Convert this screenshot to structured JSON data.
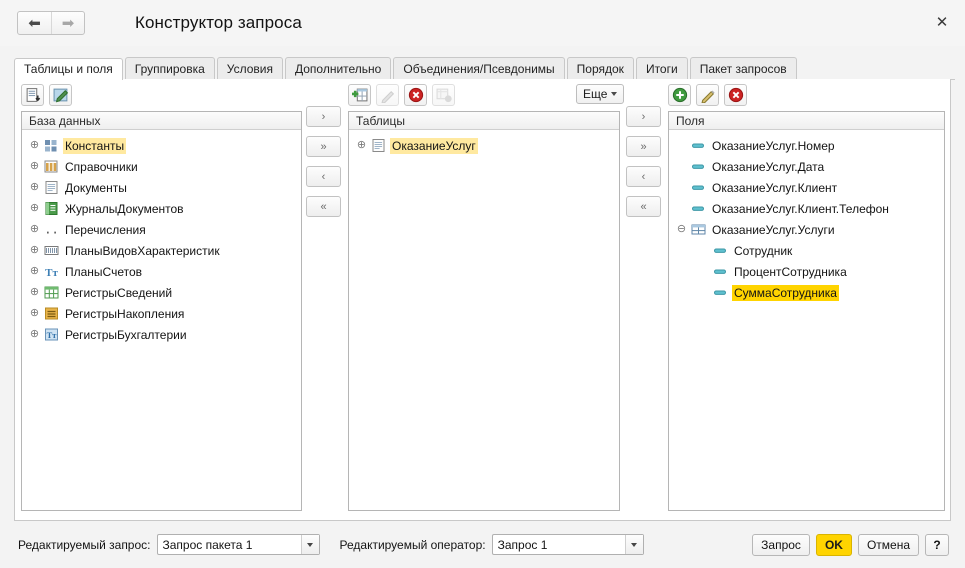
{
  "window": {
    "title": "Конструктор запроса",
    "back_icon": "arrow-left-icon",
    "forward_icon": "arrow-right-icon",
    "close_icon": "close-icon",
    "close_label": "✕"
  },
  "tabs": [
    {
      "label": "Таблицы и поля",
      "active": true
    },
    {
      "label": "Группировка",
      "active": false
    },
    {
      "label": "Условия",
      "active": false
    },
    {
      "label": "Дополнительно",
      "active": false
    },
    {
      "label": "Объединения/Псевдонимы",
      "active": false
    },
    {
      "label": "Порядок",
      "active": false
    },
    {
      "label": "Итоги",
      "active": false
    },
    {
      "label": "Пакет запросов",
      "active": false
    }
  ],
  "database_panel": {
    "header": "База данных",
    "toolbar": [
      {
        "name": "insert-table-icon",
        "enabled": true
      },
      {
        "name": "edit-query-icon",
        "enabled": true
      }
    ],
    "items": [
      {
        "label": "Константы",
        "icon": "constants-icon",
        "expandable": true,
        "highlight": "soft"
      },
      {
        "label": "Справочники",
        "icon": "catalogs-icon",
        "expandable": true,
        "highlight": "none"
      },
      {
        "label": "Документы",
        "icon": "documents-icon",
        "expandable": true,
        "highlight": "none"
      },
      {
        "label": "ЖурналыДокументов",
        "icon": "document-journals-icon",
        "expandable": true,
        "highlight": "none"
      },
      {
        "label": "Перечисления",
        "icon": "enums-icon",
        "expandable": true,
        "highlight": "none"
      },
      {
        "label": "ПланыВидовХарактеристик",
        "icon": "chart-of-characteristic-types-icon",
        "expandable": true,
        "highlight": "none"
      },
      {
        "label": "ПланыСчетов",
        "icon": "chart-of-accounts-icon",
        "expandable": true,
        "highlight": "none"
      },
      {
        "label": "РегистрыСведений",
        "icon": "information-registers-icon",
        "expandable": true,
        "highlight": "none"
      },
      {
        "label": "РегистрыНакопления",
        "icon": "accumulation-registers-icon",
        "expandable": true,
        "highlight": "none"
      },
      {
        "label": "РегистрыБухгалтерии",
        "icon": "accounting-registers-icon",
        "expandable": true,
        "highlight": "none"
      }
    ]
  },
  "transfer_left": [
    {
      "label": "›",
      "name": "move-right-button"
    },
    {
      "label": "»",
      "name": "move-all-right-button"
    },
    {
      "label": "‹",
      "name": "move-left-button"
    },
    {
      "label": "«",
      "name": "move-all-left-button"
    }
  ],
  "transfer_right": [
    {
      "label": "›",
      "name": "move-right-button"
    },
    {
      "label": "»",
      "name": "move-all-right-button"
    },
    {
      "label": "‹",
      "name": "move-left-button"
    },
    {
      "label": "«",
      "name": "move-all-left-button"
    }
  ],
  "tables_panel": {
    "header": "Таблицы",
    "more_label": "Еще",
    "toolbar": [
      {
        "name": "add-table-icon",
        "enabled": true
      },
      {
        "name": "edit-icon",
        "enabled": false
      },
      {
        "name": "delete-icon",
        "enabled": true
      },
      {
        "name": "table-options-icon",
        "enabled": false
      }
    ],
    "items": [
      {
        "label": "ОказаниеУслуг",
        "icon": "document-icon",
        "expandable": true,
        "highlight": "soft",
        "indent": 0
      }
    ]
  },
  "fields_panel": {
    "header": "Поля",
    "toolbar": [
      {
        "name": "add-field-icon",
        "enabled": true
      },
      {
        "name": "edit-field-icon",
        "enabled": true
      },
      {
        "name": "delete-field-icon",
        "enabled": true
      }
    ],
    "items": [
      {
        "label": "ОказаниеУслуг.Номер",
        "icon": "field-icon",
        "expander": "none",
        "indent": 0,
        "highlight": "none"
      },
      {
        "label": "ОказаниеУслуг.Дата",
        "icon": "field-icon",
        "expander": "none",
        "indent": 0,
        "highlight": "none"
      },
      {
        "label": "ОказаниеУслуг.Клиент",
        "icon": "field-icon",
        "expander": "none",
        "indent": 0,
        "highlight": "none"
      },
      {
        "label": "ОказаниеУслуг.Клиент.Телефон",
        "icon": "field-icon",
        "expander": "none",
        "indent": 0,
        "highlight": "none"
      },
      {
        "label": "ОказаниеУслуг.Услуги",
        "icon": "table-part-icon",
        "expander": "collapse",
        "indent": 0,
        "highlight": "none"
      },
      {
        "label": "Сотрудник",
        "icon": "field-icon",
        "expander": "none",
        "indent": 1,
        "highlight": "none"
      },
      {
        "label": "ПроцентСотрудника",
        "icon": "field-icon",
        "expander": "none",
        "indent": 1,
        "highlight": "none"
      },
      {
        "label": "СуммаСотрудника",
        "icon": "field-icon",
        "expander": "none",
        "indent": 1,
        "highlight": "strong"
      }
    ]
  },
  "footer": {
    "query_label": "Редактируемый запрос:",
    "query_value": "Запрос пакета 1",
    "operator_label": "Редактируемый оператор:",
    "operator_value": "Запрос 1",
    "buttons": [
      {
        "label": "Запрос",
        "name": "query-button",
        "style": "normal"
      },
      {
        "label": "OK",
        "name": "ok-button",
        "style": "ok"
      },
      {
        "label": "Отмена",
        "name": "cancel-button",
        "style": "normal"
      },
      {
        "label": "?",
        "name": "help-button",
        "style": "help"
      }
    ]
  },
  "colors": {
    "accent_yellow": "#ffd400",
    "soft_highlight": "#ffe9a0",
    "field_icon": "#4fb3c4",
    "green": "#3f9b3f",
    "red": "#cc2222"
  }
}
